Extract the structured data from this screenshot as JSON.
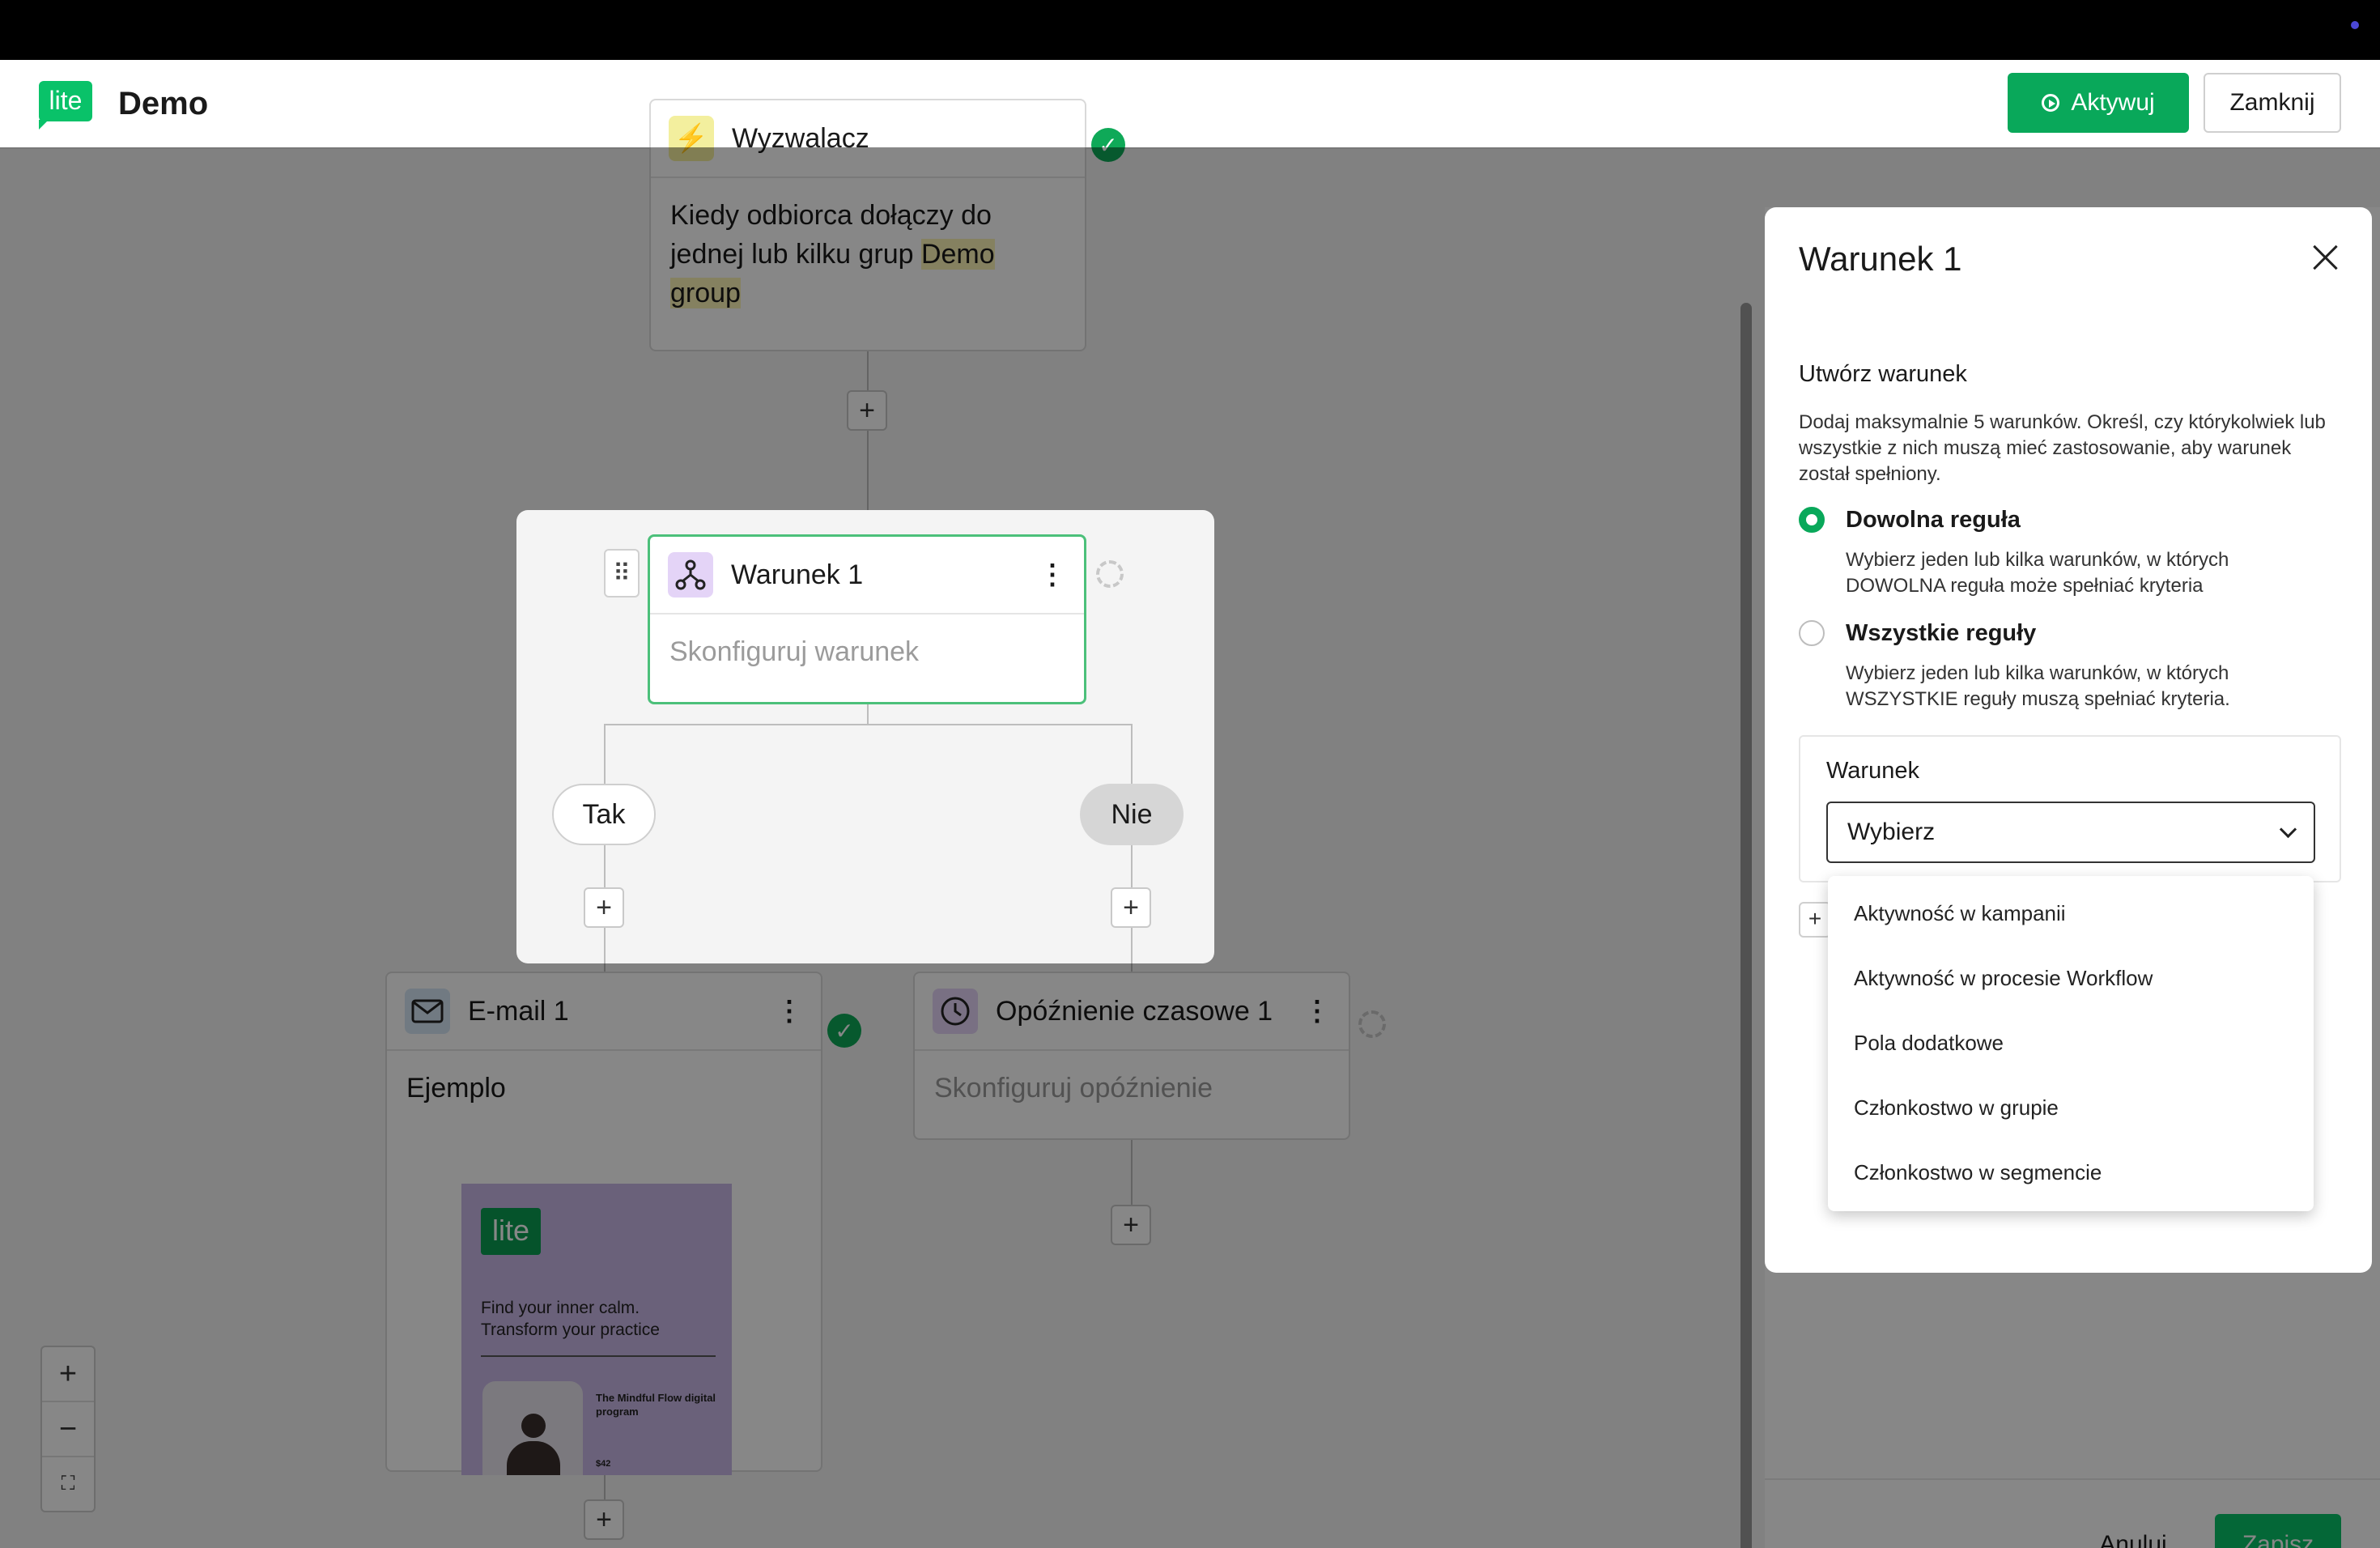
{
  "app": {
    "logo_text": "lite",
    "title": "Demo",
    "activate_label": "Aktywuj",
    "close_label": "Zamknij"
  },
  "trigger": {
    "title": "Wyzwalacz",
    "body_prefix": "Kiedy odbiorca dołączy do jednej lub kilku grup ",
    "group_name": "Demo group"
  },
  "condition_node": {
    "title": "Warunek 1",
    "body": "Skonfiguruj warunek",
    "yes_label": "Tak",
    "no_label": "Nie"
  },
  "email_node": {
    "title": "E-mail 1",
    "body": "Ejemplo"
  },
  "email_preview": {
    "logo_text": "lite",
    "headline": "Find your inner calm. Transform your practice",
    "subtitle": "The Mindful Flow digital program",
    "price": "$42"
  },
  "delay_node": {
    "title": "Opóźnienie czasowe 1",
    "body": "Skonfiguruj opóźnienie"
  },
  "panel": {
    "title": "Warunek 1",
    "section_title": "Utwórz warunek",
    "section_desc": "Dodaj maksymalnie 5 warunków. Określ, czy którykolwiek lub wszystkie z nich muszą mieć zastosowanie, aby warunek został spełniony.",
    "options": [
      {
        "label": "Dowolna reguła",
        "desc": "Wybierz jeden lub kilka warunków, w których DOWOLNA reguła może spełniać kryteria",
        "selected": true
      },
      {
        "label": "Wszystkie reguły",
        "desc": "Wybierz jeden lub kilka warunków, w których WSZYSTKIE reguły muszą spełniać kryteria.",
        "selected": false
      }
    ],
    "condition_label": "Warunek",
    "select_value": "Wybierz",
    "dropdown_items": [
      "Aktywność w kampanii",
      "Aktywność w procesie Workflow",
      "Pola dodatkowe",
      "Członkostwo w grupie",
      "Członkostwo w segmencie"
    ],
    "cancel_label": "Anuluj",
    "save_label": "Zapisz"
  },
  "colors": {
    "accent": "#09a85a",
    "condition_icon_bg": "#e4d4f7",
    "email_icon_bg": "#d6e6f5",
    "delay_icon_bg": "#e4d4f7",
    "trigger_icon_bg": "#f3ef9e"
  }
}
